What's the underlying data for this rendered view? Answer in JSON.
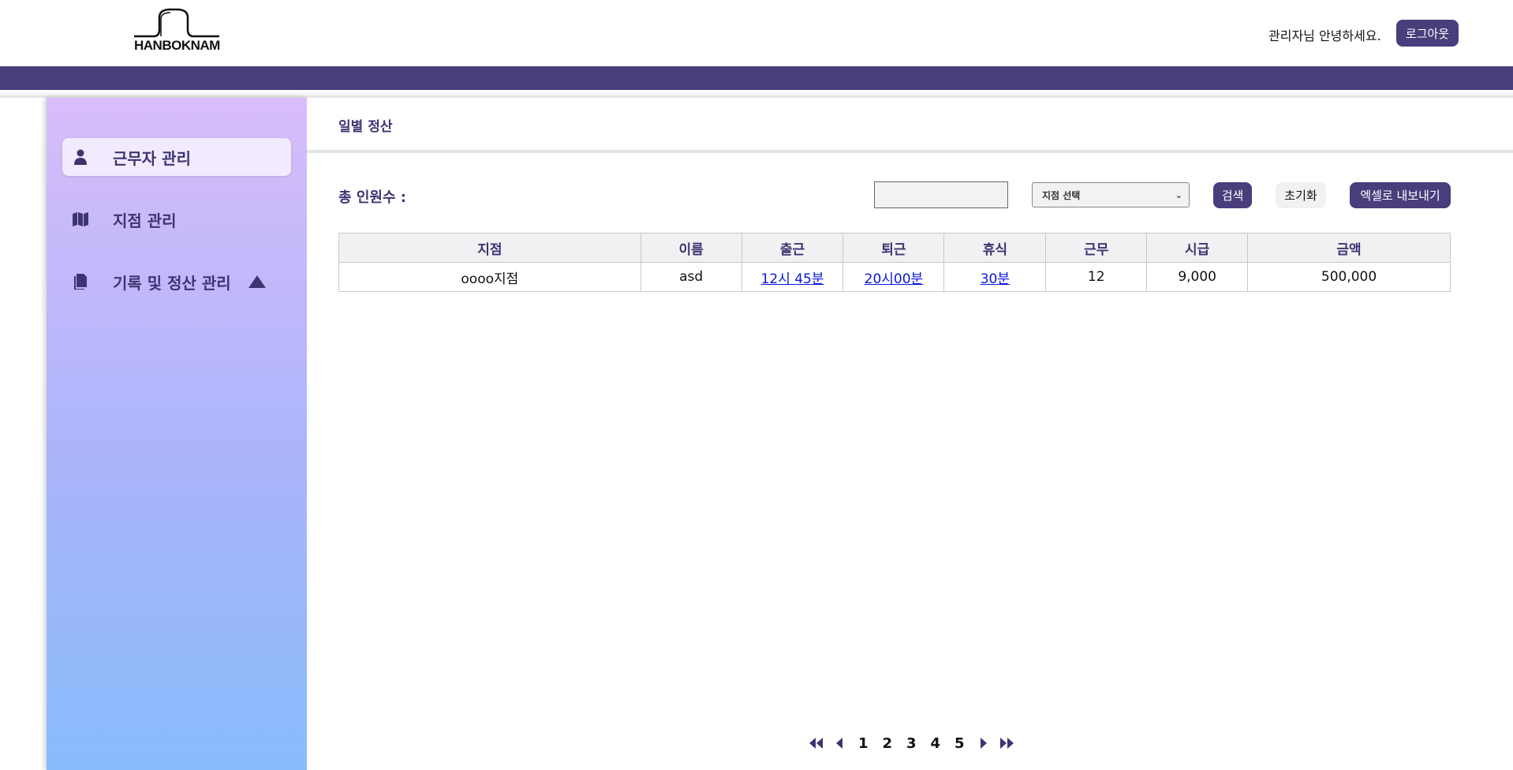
{
  "header": {
    "logo_text": "HANBOKNAM",
    "greeting": "관리자님 안녕하세요.",
    "logout_label": "로그아웃"
  },
  "colors": {
    "brand": "#4a3d7c",
    "sidebar_top": "#d8bdfa",
    "sidebar_bottom": "#88bcfb",
    "link": "#0a16d8"
  },
  "sidebar": {
    "items": [
      {
        "label": "근무자 관리",
        "icon": "person-icon",
        "active": true
      },
      {
        "label": "지점 관리",
        "icon": "map-icon",
        "active": false
      },
      {
        "label": "기록 및 정산 관리",
        "icon": "document-icon",
        "active": false,
        "expanded": true
      }
    ]
  },
  "main": {
    "title": "일별 정산",
    "total_label": "총 인원수 :",
    "search_value": "",
    "branch_select": "지점 선택",
    "search_label": "검색",
    "reset_label": "초기화",
    "export_label": "엑셀로 내보내기"
  },
  "table": {
    "headers": [
      "지점",
      "이름",
      "출근",
      "퇴근",
      "휴식",
      "근무",
      "시급",
      "금액"
    ],
    "rows": [
      [
        "oooo지점",
        "asd",
        "12시 45분",
        "20시00분",
        "30분",
        "12",
        "9,000",
        "500,000"
      ]
    ]
  },
  "pagination": {
    "pages": [
      "1",
      "2",
      "3",
      "4",
      "5"
    ],
    "current": "1"
  }
}
